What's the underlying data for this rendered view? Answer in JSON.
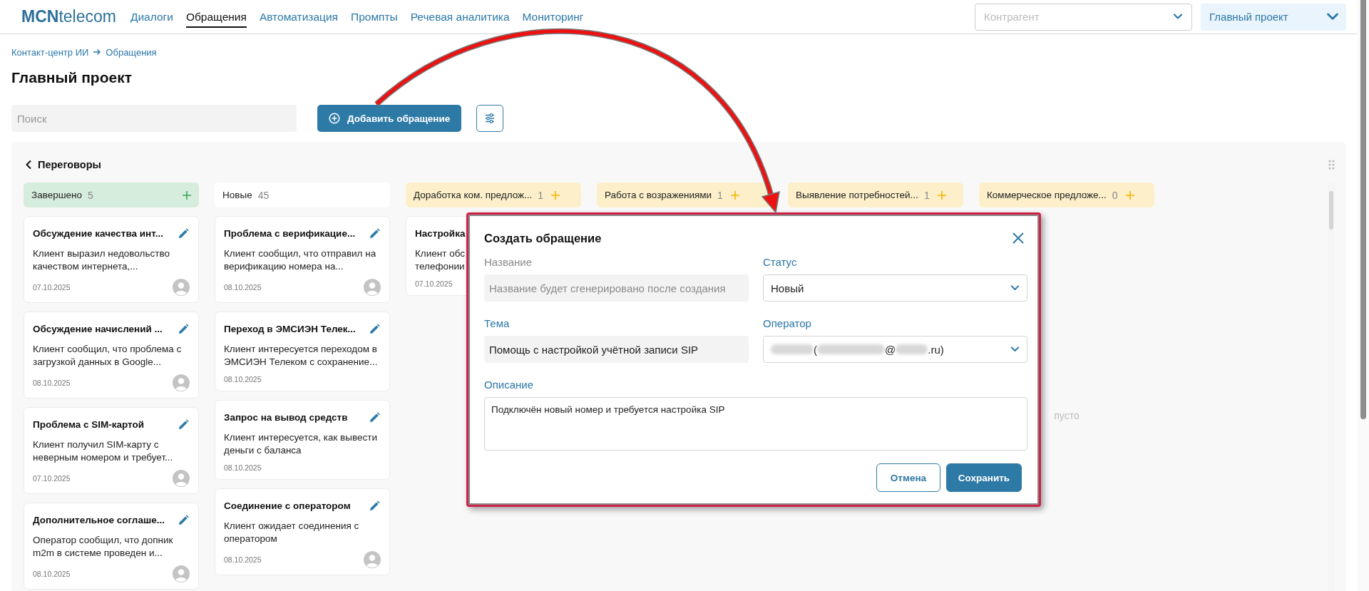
{
  "header": {
    "logo": {
      "bold": "MCN",
      "rest": "telecom"
    },
    "nav": [
      {
        "label": "Диалоги",
        "selected": false
      },
      {
        "label": "Обращения",
        "selected": true
      },
      {
        "label": "Автоматизация",
        "selected": false
      },
      {
        "label": "Промпты",
        "selected": false
      },
      {
        "label": "Речевая аналитика",
        "selected": false
      },
      {
        "label": "Мониторинг",
        "selected": false
      }
    ],
    "counterparty_select": {
      "placeholder": "Контрагент"
    },
    "project_select": {
      "value": "Главный проект"
    }
  },
  "breadcrumbs": [
    "Контакт-центр ИИ",
    "Обращения"
  ],
  "page_title": "Главный проект",
  "toolbar": {
    "search": {
      "placeholder": "Поиск"
    },
    "add_button": "Добавить обращение"
  },
  "board": {
    "title": "Переговоры",
    "columns": [
      {
        "kind": "done",
        "title": "Завершено",
        "count": "5",
        "cards": [
          {
            "title": "Обсуждение качества инт...",
            "description": "Клиент выразил недовольство качеством интернета,...",
            "date": "07.10.2025",
            "avatar": true
          },
          {
            "title": "Обсуждение начислений ...",
            "description": "Клиент сообщил, что проблема с загрузкой данных в Google...",
            "date": "08.10.2025",
            "avatar": true
          },
          {
            "title": "Проблема с SIM-картой",
            "description": "Клиент получил SIM-карту с неверным номером и требует...",
            "date": "07.10.2025",
            "avatar": true
          },
          {
            "title": "Дополнительное соглаше...",
            "description": "Оператор сообщил, что допник m2m в системе проведен и...",
            "date": "08.10.2025",
            "avatar": true
          }
        ]
      },
      {
        "kind": "new",
        "title": "Новые",
        "count": "45",
        "cards": [
          {
            "title": "Проблема с верификацие...",
            "description": "Клиент сообщил, что отправил на верификацию номера на...",
            "date": "08.10.2025",
            "avatar": true
          },
          {
            "title": "Переход в ЭМСИЭН Телек...",
            "description": "Клиент интересуется переходом в ЭМСИЭН Телеком с сохранение...",
            "date": "08.10.2025",
            "avatar": false
          },
          {
            "title": "Запрос на вывод средств",
            "description": "Клиент интересуется, как вывести деньги с баланса",
            "date": "08.10.2025",
            "avatar": false
          },
          {
            "title": "Соединение с оператором",
            "description": "Клиент ожидает соединения с оператором",
            "date": "08.10.2025",
            "avatar": true
          }
        ]
      },
      {
        "kind": "stage",
        "title": "Доработка ком. предлож...",
        "count": "1",
        "cards": [
          {
            "title": "Настройка",
            "description": "Клиент обс\nтелефонии",
            "date": "07.10.2025",
            "avatar": false
          }
        ]
      },
      {
        "kind": "stage",
        "title": "Работа с возражениями",
        "count": "1"
      },
      {
        "kind": "stage",
        "title": "Выявление потребностей...",
        "count": "1"
      },
      {
        "kind": "stage",
        "title": "Коммерческое предложе...",
        "count": "0",
        "empty_label": "пусто"
      }
    ]
  },
  "dialog": {
    "title": "Создать обращение",
    "fields": [
      {
        "kind": "text",
        "label": "Название",
        "placeholder": "Название будет сгенерировано после создания",
        "disabled": true
      },
      {
        "kind": "select",
        "label": "Статус",
        "value": "Новый"
      },
      {
        "kind": "text",
        "label": "Тема",
        "value": "Помощь с настройкой учётной записи SIP",
        "disabled": false
      },
      {
        "kind": "redacted_select",
        "label": "Оператор",
        "value_parts": [
          "(",
          "@",
          ".ru)"
        ]
      },
      {
        "kind": "textarea",
        "label": "Описание",
        "value": "Подключён новый номер и требуется настройка SIP"
      }
    ],
    "buttons": [
      {
        "kind": "secondary",
        "label": "Отмена"
      },
      {
        "kind": "primary",
        "label": "Сохранить"
      }
    ]
  }
}
